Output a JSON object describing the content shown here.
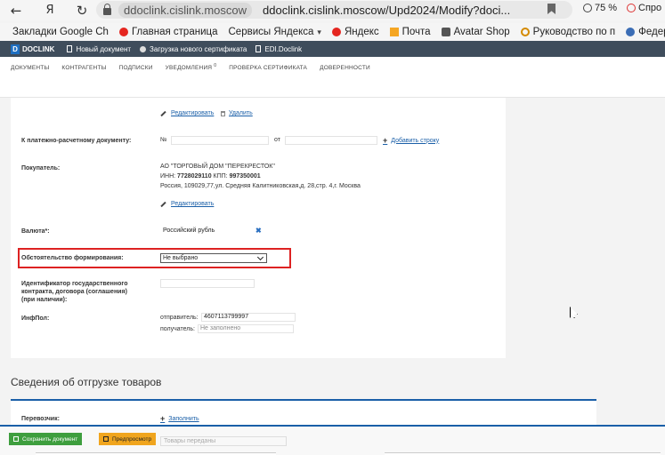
{
  "browser": {
    "back": "←",
    "yandex": "Я",
    "reload": "↻",
    "domain": "ddoclink.cislink.moscow",
    "url": "ddoclink.cislink.moscow/Upd2024/Modify?doci...",
    "zoom": "75 %",
    "help": "Спро"
  },
  "bookmarks": [
    {
      "label": "Закладки Google Ch",
      "icon": "none"
    },
    {
      "label": "Главная страница",
      "icon": "yandex-icon"
    },
    {
      "label": "Сервисы Яндекса",
      "icon": "none"
    },
    {
      "label": "Яндекс",
      "icon": "yandex-icon"
    },
    {
      "label": "Почта",
      "icon": "mail-icon"
    },
    {
      "label": "Avatar Shop",
      "icon": "avatar-icon"
    },
    {
      "label": "Руководство по п",
      "icon": "gear-icon"
    },
    {
      "label": "Федераль",
      "icon": "federal-icon"
    }
  ],
  "app": {
    "logo_letter": "D",
    "logo_text": "DOCLINK",
    "top_links": [
      "Новый документ",
      "Загрузка нового сертификата",
      "EDI.Doclink"
    ],
    "nav": [
      "ДОКУМЕНТЫ",
      "КОНТРАГЕНТЫ",
      "ПОДПИСКИ",
      "УВЕДОМЛЕНИЯ",
      "ПРОВЕРКА СЕРТИФИКАТА",
      "ДОВЕРЕННОСТИ"
    ],
    "notifications_count": "0"
  },
  "form": {
    "edit_link": "Редактировать",
    "delete_link": "Удалить",
    "payment_doc_label": "К платежно-расчетному документу:",
    "number_prefix": "№",
    "from_label": "от",
    "add_row": "Добавить строку",
    "buyer_label": "Покупатель:",
    "buyer_name": "АО \"ТОРГОВЫЙ ДОМ \"ПЕРЕКРЕСТОК\"",
    "buyer_inn_prefix": "ИНН:",
    "buyer_inn": "7728029110",
    "buyer_kpp_prefix": "КПП:",
    "buyer_kpp": "997350001",
    "buyer_address": "Россия, 109029,77,ул. Средняя Калитниковская,д. 28,стр. 4,г. Москва",
    "buyer_edit_link": "Редактировать",
    "currency_label": "Валюта*:",
    "currency_value": "Российский рубль",
    "circumstance_label": "Обстоятельство формирования:",
    "circumstance_value": "Не выбрано",
    "contract_id_label_1": "Идентификатор государственного",
    "contract_id_label_2": "контракта, договора (соглашения)",
    "contract_id_label_3": "(при наличии):",
    "infpol_label": "ИнфПол:",
    "sender_label": "отправитель:",
    "sender_value": "4607113799997",
    "receiver_label": "получатель:",
    "receiver_placeholder": "Не заполнено"
  },
  "shipment": {
    "title": "Сведения об отгрузке товаров",
    "carrier_label": "Перевозчик:",
    "fill_link": "Заполнить"
  },
  "bottom": {
    "save_button": "Сохранить документ",
    "preview_button": "Предпросмотр",
    "ghost_select": "Товары переданы"
  }
}
